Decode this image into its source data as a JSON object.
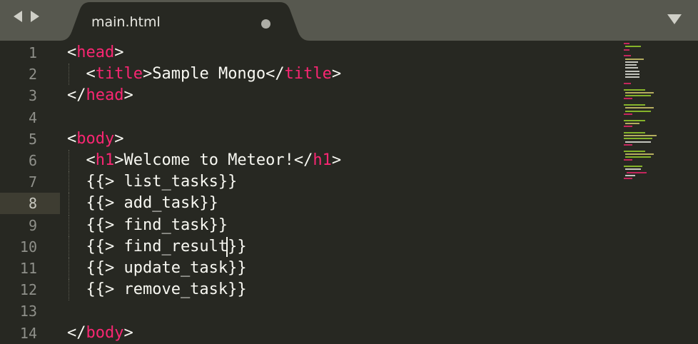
{
  "tabbar": {
    "tab_title": "main.html",
    "nav_back_icon": "chevron-left-icon",
    "nav_forward_icon": "chevron-right-icon",
    "dirty_indicator_icon": "unsaved-dot-icon",
    "menu_icon": "triangle-down-icon"
  },
  "editor": {
    "current_line": 8,
    "lines": [
      {
        "number": "1",
        "tokens": [
          [
            "p",
            "<"
          ],
          [
            "t",
            "head"
          ],
          [
            "p",
            ">"
          ]
        ]
      },
      {
        "number": "2",
        "tokens": [
          [
            "p",
            "  <"
          ],
          [
            "t",
            "title"
          ],
          [
            "p",
            ">Sample Mongo</"
          ],
          [
            "t",
            "title"
          ],
          [
            "p",
            ">"
          ]
        ]
      },
      {
        "number": "3",
        "tokens": [
          [
            "p",
            "</"
          ],
          [
            "t",
            "head"
          ],
          [
            "p",
            ">"
          ]
        ]
      },
      {
        "number": "4",
        "tokens": []
      },
      {
        "number": "5",
        "tokens": [
          [
            "p",
            "<"
          ],
          [
            "t",
            "body"
          ],
          [
            "p",
            ">"
          ]
        ]
      },
      {
        "number": "6",
        "tokens": [
          [
            "p",
            "  <"
          ],
          [
            "t",
            "h1"
          ],
          [
            "p",
            ">Welcome to Meteor!</"
          ],
          [
            "t",
            "h1"
          ],
          [
            "p",
            ">"
          ]
        ]
      },
      {
        "number": "7",
        "tokens": [
          [
            "p",
            "  {{> list_tasks}}"
          ]
        ]
      },
      {
        "number": "8",
        "tokens": [
          [
            "p",
            "  {{> add_task}}"
          ]
        ]
      },
      {
        "number": "9",
        "tokens": [
          [
            "p",
            "  {{> find_task}}"
          ]
        ]
      },
      {
        "number": "10",
        "tokens": [
          [
            "p",
            "  {{> find_result}}"
          ]
        ]
      },
      {
        "number": "11",
        "tokens": [
          [
            "p",
            "  {{> update_task}}"
          ]
        ]
      },
      {
        "number": "12",
        "tokens": [
          [
            "p",
            "  {{> remove_task}}"
          ]
        ]
      },
      {
        "number": "13",
        "tokens": []
      },
      {
        "number": "14",
        "tokens": [
          [
            "p",
            "</"
          ],
          [
            "t",
            "body"
          ],
          [
            "p",
            ">"
          ]
        ]
      }
    ]
  },
  "colors": {
    "background": "#272822",
    "tabbar": "#57584f",
    "tab_active": "#272822",
    "tag": "#f92672",
    "text": "#f8f8f2",
    "line_number": "#8f908a",
    "current_line_highlight": "#3e3d32"
  }
}
